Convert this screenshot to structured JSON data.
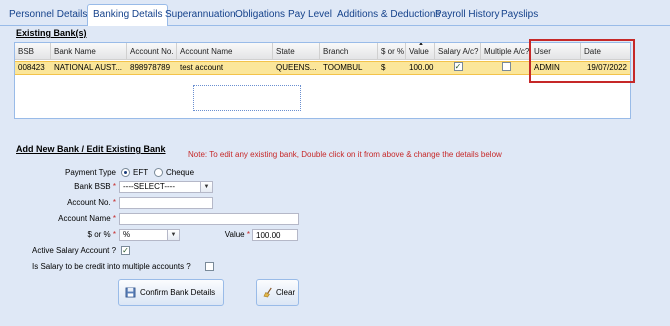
{
  "tabs": [
    {
      "label": "Personnel Details",
      "active": false
    },
    {
      "label": "Banking Details",
      "active": true
    },
    {
      "label": "Superannuation",
      "active": false
    },
    {
      "label": "Obligations",
      "active": false
    },
    {
      "label": "Pay Level",
      "active": false
    },
    {
      "label": "Additions & Deductions",
      "active": false
    },
    {
      "label": "Payroll History",
      "active": false
    },
    {
      "label": "Payslips",
      "active": false
    }
  ],
  "existing": {
    "title": "Existing Bank(s)",
    "columns": [
      "BSB",
      "Bank Name",
      "Account No.",
      "Account Name",
      "State",
      "Branch",
      "$ or %",
      "Value",
      "Salary A/c?",
      "Multiple A/c?",
      "User",
      "Date"
    ],
    "sort_column": "Value",
    "rows": [
      {
        "bsb": "008423",
        "bank_name": "NATIONAL AUST...",
        "account_no": "898978789",
        "account_name": "test account",
        "state": "QUEENS...",
        "branch": "TOOMBUL",
        "dollar_or_pct": "$",
        "value": "100.00",
        "salary_ac": true,
        "multiple_ac": false,
        "user": "ADMIN",
        "date": "19/07/2022"
      }
    ],
    "note": "Note: To edit any existing bank, Double click on it from above & change the details below"
  },
  "form": {
    "title": "Add New Bank / Edit Existing Bank",
    "payment_type_label": "Payment Type",
    "payment_options": [
      "EFT",
      "Cheque"
    ],
    "payment_selected": "EFT",
    "bank_bsb_label": "Bank BSB",
    "bank_bsb_value": "----SELECT----",
    "account_no_label": "Account No.",
    "account_no_value": "",
    "account_name_label": "Account Name",
    "account_name_value": "",
    "dollar_pct_label": "$ or %",
    "dollar_pct_value": "%",
    "value_label": "Value",
    "value_value": "100.00",
    "active_salary_label": "Active Salary Account ?",
    "active_salary_checked": true,
    "multiple_label": "Is Salary to be credit into multiple accounts ?",
    "multiple_checked": false,
    "required_mark": "*",
    "confirm_label": "Confirm Bank Details",
    "clear_label": "Clear"
  },
  "colors": {
    "tab_text": "#15428b",
    "selected_row": "#fbe69a",
    "note_red": "#c62828",
    "highlight_red": "#c62828"
  }
}
